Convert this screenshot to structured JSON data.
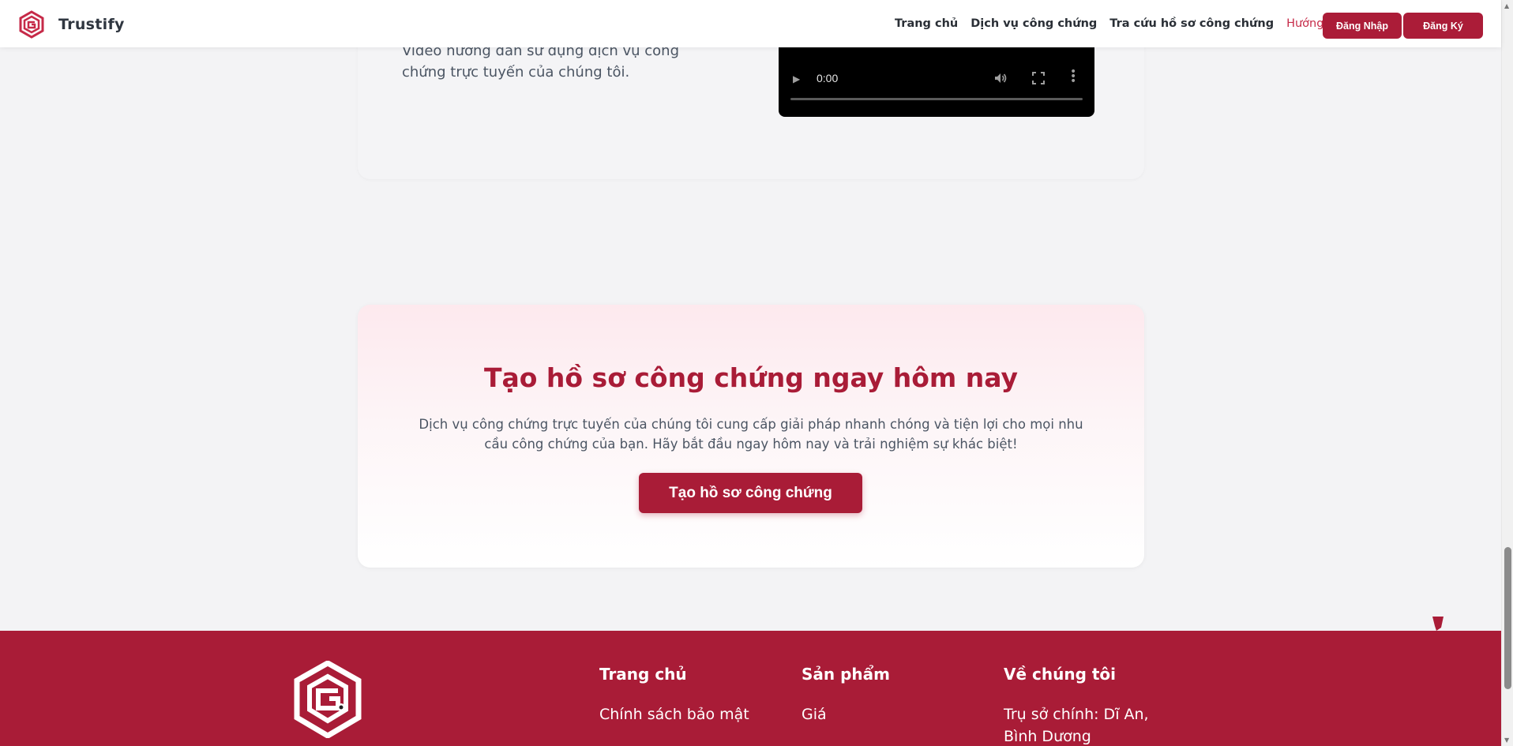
{
  "header": {
    "brand": "Trustify",
    "nav": [
      {
        "label": "Trang chủ",
        "active": false
      },
      {
        "label": "Dịch vụ công chứng",
        "active": false
      },
      {
        "label": "Tra cứu hồ sơ công chứng",
        "active": false
      },
      {
        "label": "Hướng dẫn",
        "active": true
      }
    ],
    "login": "Đăng Nhập",
    "register": "Đăng Ký"
  },
  "video_section": {
    "description": "Video hướng dẫn sử dụng dịch vụ công chứng trực tuyến của chúng tôi.",
    "player": {
      "time": "0:00",
      "icons": [
        "play-icon",
        "volume-icon",
        "fullscreen-icon",
        "more-vert-icon"
      ]
    }
  },
  "cta": {
    "title": "Tạo hồ sơ công chứng ngay hôm nay",
    "text": "Dịch vụ công chứng trực tuyến của chúng tôi cung cấp giải pháp nhanh chóng và tiện lợi cho mọi nhu cầu công chứng của bạn. Hãy bắt đầu ngay hôm nay và trải nghiệm sự khác biệt!",
    "button": "Tạo hồ sơ công chứng"
  },
  "footer": {
    "columns": [
      {
        "title": "Trang chủ",
        "link": "Chính sách bảo mật"
      },
      {
        "title": "Sản phẩm",
        "link": "Giá"
      },
      {
        "title": "Về chúng tôi",
        "link": "Trụ sở chính: Dĩ An, Bình Dương"
      }
    ]
  },
  "colors": {
    "brand": "#a91c37",
    "nav_active": "#c62a48",
    "background": "#f3f3f5"
  }
}
